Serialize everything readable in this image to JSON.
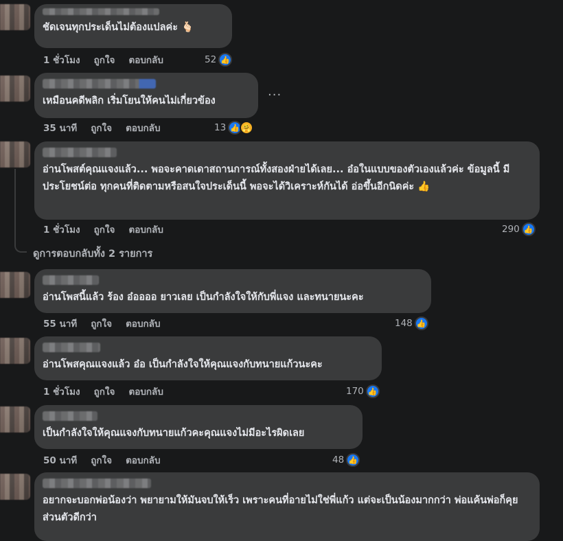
{
  "ui": {
    "like_label": "ถูกใจ",
    "reply_label": "ตอบกลับ"
  },
  "comments": [
    {
      "text": "ชัดเจนทุกประเด็นไม่ต้องแปลค่ะ 🫰🏻",
      "time": "1 ชั่วโมง",
      "like_label": "ถูกใจ",
      "reply_label": "ตอบกลับ",
      "reactions": "52"
    },
    {
      "text": "เหมือนคดีพลิก เริ่มโยนให้คนไม่เกี่ยวข้อง",
      "time": "35 นาที",
      "like_label": "ถูกใจ",
      "reply_label": "ตอบกลับ",
      "reactions": "13",
      "more_label": "···"
    },
    {
      "text": "อ่านโพสต์คุณแจงแล้ว... พอจะคาดเดาสถานการณ์ทั้งสองฝ่ายได้เลย... อ๋อในแบบของตัวเองแล้วค่ะ ข้อมูลนี้ มีประโยชน์ต่อ ทุกคนที่ติดตามหรือสนใจประเด็นนี้ พอจะได้วิเคราะห์กันได้ อ่อขึ้นอีกนิดค่ะ 👍",
      "time": "1 ชั่วโมง",
      "like_label": "ถูกใจ",
      "reply_label": "ตอบกลับ",
      "reactions": "290"
    },
    {
      "text": "อ่านโพสนี้แล้ว ร้อง อ๋ออออ ยาวเลย เป็นกำลังใจให้กับพี่แจง และทนายนะคะ",
      "time": "55 นาที",
      "like_label": "ถูกใจ",
      "reply_label": "ตอบกลับ",
      "reactions": "148"
    },
    {
      "text": "อ่านโพสคุณแจงแล้ว อ๋อ เป็นกำลังใจให้คุณแจงกับทนายแก้วนะคะ",
      "time": "1 ชั่วโมง",
      "like_label": "ถูกใจ",
      "reply_label": "ตอบกลับ",
      "reactions": "170"
    },
    {
      "text": "เป็นกำลังใจให้คุณแจงกับทนายแก้วคะคุณแจงไม่มีอะไรผิดเลย",
      "time": "50 นาที",
      "like_label": "ถูกใจ",
      "reply_label": "ตอบกลับ",
      "reactions": "48"
    },
    {
      "text": "อยากจะบอกพ่อน้องว่า พยายามให้มันจบให้เร็ว เพราะคนที่อายไม่ใช่พี่แก้ว แต่จะเป็นน้องมากกว่า พ่อแค้นพ่อก็คุยส่วนตัวดีกว่า"
    }
  ],
  "view_replies": "ดูการตอบกลับทั้ง 2 รายการ",
  "colors": {
    "background": "#18191a",
    "bubble": "#3a3b3c",
    "text": "#e4e6eb",
    "meta": "#b0b3b8",
    "like_blue": "#1877f2"
  }
}
